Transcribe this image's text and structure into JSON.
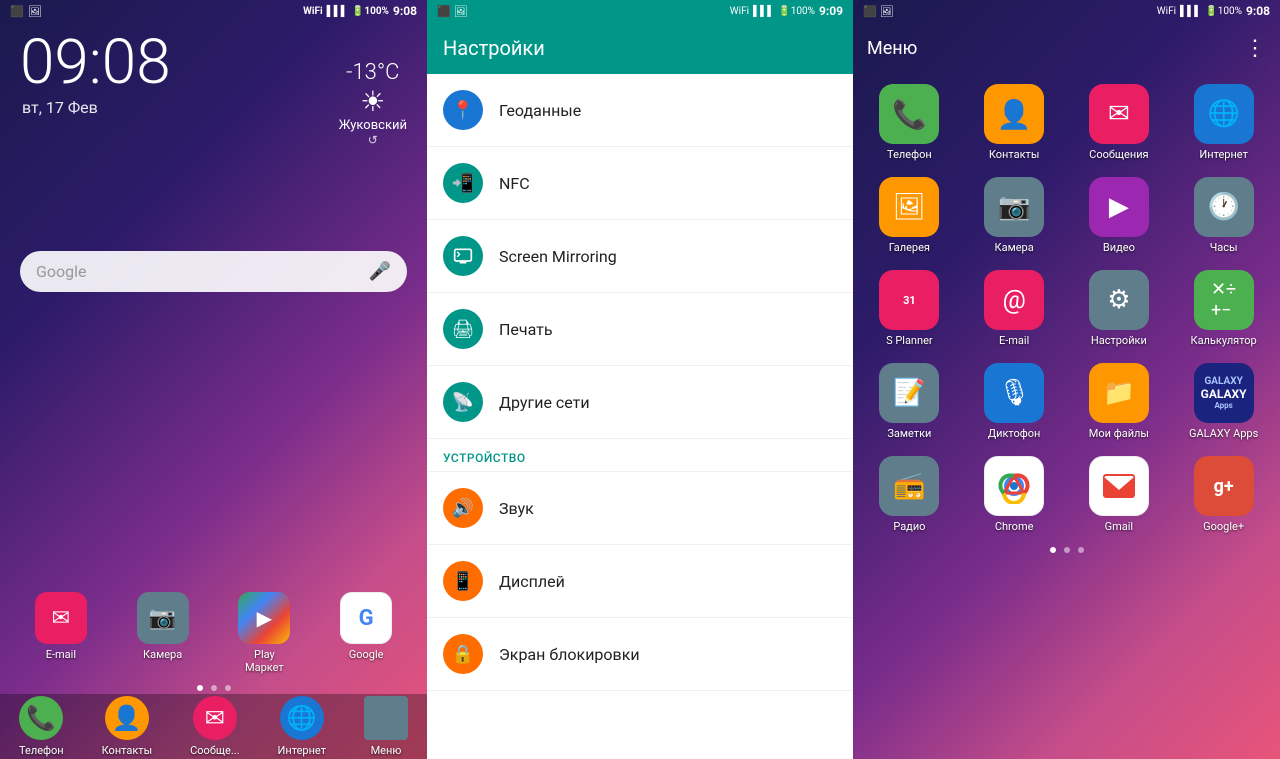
{
  "panel1": {
    "statusBar": {
      "time": "9:08",
      "battery": "100%",
      "signal": "▌▌▌▌",
      "wifi": "WiFi"
    },
    "time": "09:08",
    "date": "вт, 17 Фев",
    "weather": {
      "temp": "-13°C",
      "city": "Жуковский"
    },
    "searchPlaceholder": "Google",
    "dockApps": [
      {
        "label": "E-mail",
        "iconChar": "✉",
        "color": "#e91e63"
      },
      {
        "label": "Камера",
        "iconChar": "◎",
        "color": "#607d8b"
      },
      {
        "label": "Play\nМаркет",
        "iconChar": "▶",
        "color": "#1976d2"
      },
      {
        "label": "Google",
        "iconChar": "G",
        "color": "#4285f4"
      }
    ],
    "taskbarApps": [
      {
        "label": "Телефон",
        "iconChar": "📞",
        "color": "#4caf50"
      },
      {
        "label": "Контакты",
        "iconChar": "👤",
        "color": "#ff9800"
      },
      {
        "label": "Сообще...",
        "iconChar": "✉",
        "color": "#e91e63"
      },
      {
        "label": "Интернет",
        "iconChar": "🌐",
        "color": "#1976d2"
      },
      {
        "label": "Меню",
        "iconChar": "⋮⋮",
        "color": "#607d8b"
      }
    ]
  },
  "panel2": {
    "header": "Настройки",
    "items": [
      {
        "label": "Геоданные",
        "iconChar": "📍",
        "colorClass": "icon-blue"
      },
      {
        "label": "NFC",
        "iconChar": "📲",
        "colorClass": "icon-teal"
      },
      {
        "label": "Screen Mirroring",
        "iconChar": "📺",
        "colorClass": "icon-teal"
      },
      {
        "label": "Печать",
        "iconChar": "🖨",
        "colorClass": "icon-teal"
      },
      {
        "label": "Другие сети",
        "iconChar": "📡",
        "colorClass": "icon-teal"
      }
    ],
    "sectionHeader": "УСТРОЙСТВО",
    "deviceItems": [
      {
        "label": "Звук",
        "iconChar": "🔊",
        "colorClass": "icon-orange"
      },
      {
        "label": "Дисплей",
        "iconChar": "📱",
        "colorClass": "icon-orange"
      },
      {
        "label": "Экран блокировки",
        "iconChar": "🔒",
        "colorClass": "icon-orange"
      }
    ]
  },
  "panel3": {
    "statusBar": {
      "time": "9:08"
    },
    "title": "Меню",
    "menuDots": "⋮",
    "apps": [
      {
        "label": "Телефон",
        "iconChar": "📞",
        "colorClass": "ic-phone"
      },
      {
        "label": "Контакты",
        "iconChar": "👤",
        "colorClass": "ic-contacts"
      },
      {
        "label": "Сообщения",
        "iconChar": "✉",
        "colorClass": "ic-messages"
      },
      {
        "label": "Интернет",
        "iconChar": "🌐",
        "colorClass": "ic-internet"
      },
      {
        "label": "Галерея",
        "iconChar": "🖼",
        "colorClass": "ic-gallery"
      },
      {
        "label": "Камера",
        "iconChar": "📷",
        "colorClass": "ic-camera"
      },
      {
        "label": "Видео",
        "iconChar": "▶",
        "colorClass": "ic-video"
      },
      {
        "label": "Часы",
        "iconChar": "🕐",
        "colorClass": "ic-clock"
      },
      {
        "label": "S Planner",
        "iconChar": "31",
        "colorClass": "ic-splanner"
      },
      {
        "label": "E-mail",
        "iconChar": "@",
        "colorClass": "ic-email"
      },
      {
        "label": "Настройки",
        "iconChar": "⚙",
        "colorClass": "ic-settings"
      },
      {
        "label": "Калькулятор",
        "iconChar": "⊞",
        "colorClass": "ic-calc"
      },
      {
        "label": "Заметки",
        "iconChar": "📝",
        "colorClass": "ic-notes"
      },
      {
        "label": "Диктофон",
        "iconChar": "🎙",
        "colorClass": "ic-recorder"
      },
      {
        "label": "Мои файлы",
        "iconChar": "📁",
        "colorClass": "ic-files"
      },
      {
        "label": "GALAXY Apps",
        "iconChar": "G",
        "colorClass": "ic-galaxy"
      },
      {
        "label": "Радио",
        "iconChar": "📻",
        "colorClass": "ic-radio"
      },
      {
        "label": "Chrome",
        "iconChar": "C",
        "colorClass": "ic-chrome"
      },
      {
        "label": "Gmail",
        "iconChar": "M",
        "colorClass": "ic-gmail"
      },
      {
        "label": "Google+",
        "iconChar": "g+",
        "colorClass": "ic-gplus"
      }
    ]
  }
}
